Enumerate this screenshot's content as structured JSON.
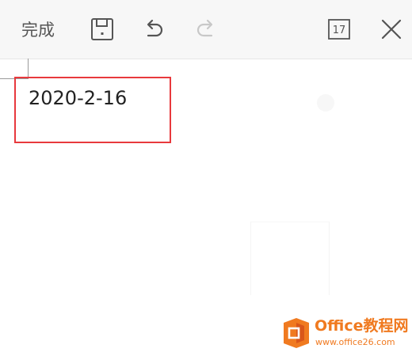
{
  "toolbar": {
    "done_label": "完成",
    "calendar_day": "17",
    "icons": [
      "save-icon",
      "undo-icon",
      "redo-icon",
      "calendar-icon",
      "close-icon"
    ],
    "redo_enabled": false
  },
  "content": {
    "date_text": "2020-2-16",
    "highlight_color": "#e8393d"
  },
  "watermark": {
    "title": "Office教程网",
    "url": "www.office26.com",
    "color": "#f07a20"
  }
}
